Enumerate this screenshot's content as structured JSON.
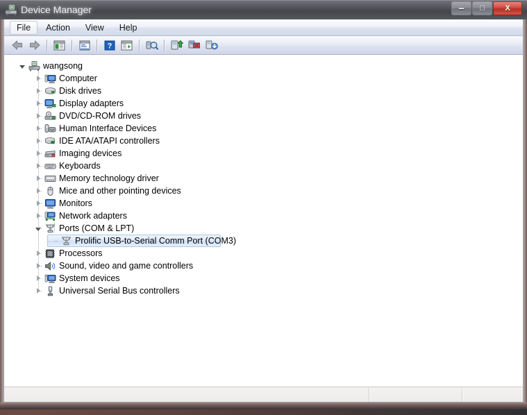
{
  "window": {
    "title": "Device Manager",
    "app_icon": "device-manager-icon",
    "caption": {
      "minimize_label": "–",
      "maximize_label": "□",
      "close_label": "X"
    }
  },
  "menubar": {
    "items": [
      {
        "label": "File",
        "state": "hot"
      },
      {
        "label": "Action",
        "state": "normal"
      },
      {
        "label": "View",
        "state": "normal"
      },
      {
        "label": "Help",
        "state": "normal"
      }
    ]
  },
  "toolbar": {
    "items": [
      {
        "type": "button",
        "icon": "back-arrow-icon",
        "label": "Back"
      },
      {
        "type": "button",
        "icon": "forward-arrow-icon",
        "label": "Forward"
      },
      {
        "type": "separator"
      },
      {
        "type": "button",
        "icon": "show-console-tree-icon",
        "label": "Show/Hide Console Tree"
      },
      {
        "type": "separator"
      },
      {
        "type": "button",
        "icon": "properties-icon",
        "label": "Properties"
      },
      {
        "type": "separator"
      },
      {
        "type": "button",
        "icon": "help-icon",
        "label": "Help"
      },
      {
        "type": "button",
        "icon": "show-detail-pane-icon",
        "label": "Show/Hide Action Pane"
      },
      {
        "type": "separator"
      },
      {
        "type": "button",
        "icon": "scan-hardware-changes-icon",
        "label": "Scan for hardware changes"
      },
      {
        "type": "separator"
      },
      {
        "type": "button",
        "icon": "update-driver-icon",
        "label": "Update Driver Software"
      },
      {
        "type": "button",
        "icon": "disable-device-icon",
        "label": "Disable"
      },
      {
        "type": "button",
        "icon": "uninstall-device-icon",
        "label": "Uninstall"
      }
    ]
  },
  "tree": {
    "root": {
      "label": "wangsong",
      "icon": "computer-root-icon",
      "expanded": true,
      "depth": 0
    },
    "nodes": [
      {
        "label": "Computer",
        "icon": "computer-icon",
        "depth": 1,
        "expanded": false,
        "selected": false
      },
      {
        "label": "Disk drives",
        "icon": "disk-drive-icon",
        "depth": 1,
        "expanded": false,
        "selected": false
      },
      {
        "label": "Display adapters",
        "icon": "display-adapter-icon",
        "depth": 1,
        "expanded": false,
        "selected": false
      },
      {
        "label": "DVD/CD-ROM drives",
        "icon": "dvd-cdrom-icon",
        "depth": 1,
        "expanded": false,
        "selected": false
      },
      {
        "label": "Human Interface Devices",
        "icon": "hid-icon",
        "depth": 1,
        "expanded": false,
        "selected": false
      },
      {
        "label": "IDE ATA/ATAPI controllers",
        "icon": "ide-controller-icon",
        "depth": 1,
        "expanded": false,
        "selected": false
      },
      {
        "label": "Imaging devices",
        "icon": "imaging-device-icon",
        "depth": 1,
        "expanded": false,
        "selected": false
      },
      {
        "label": "Keyboards",
        "icon": "keyboard-icon",
        "depth": 1,
        "expanded": false,
        "selected": false
      },
      {
        "label": "Memory technology driver",
        "icon": "memory-technology-icon",
        "depth": 1,
        "expanded": false,
        "selected": false
      },
      {
        "label": "Mice and other pointing devices",
        "icon": "mouse-icon",
        "depth": 1,
        "expanded": false,
        "selected": false
      },
      {
        "label": "Monitors",
        "icon": "monitor-icon",
        "depth": 1,
        "expanded": false,
        "selected": false
      },
      {
        "label": "Network adapters",
        "icon": "network-adapter-icon",
        "depth": 1,
        "expanded": false,
        "selected": false
      },
      {
        "label": "Ports (COM & LPT)",
        "icon": "port-icon",
        "depth": 1,
        "expanded": true,
        "selected": false
      },
      {
        "label": "Prolific USB-to-Serial Comm Port (COM3)",
        "icon": "port-icon",
        "depth": 2,
        "expanded": null,
        "selected": true
      },
      {
        "label": "Processors",
        "icon": "processor-icon",
        "depth": 1,
        "expanded": false,
        "selected": false
      },
      {
        "label": "Sound, video and game controllers",
        "icon": "sound-controller-icon",
        "depth": 1,
        "expanded": false,
        "selected": false
      },
      {
        "label": "System devices",
        "icon": "system-device-icon",
        "depth": 1,
        "expanded": false,
        "selected": false
      },
      {
        "label": "Universal Serial Bus controllers",
        "icon": "usb-controller-icon",
        "depth": 1,
        "expanded": false,
        "selected": false
      }
    ]
  },
  "statusbar": {
    "cells": [
      "",
      "",
      ""
    ]
  },
  "colors": {
    "selection_border": "#a6cbe8",
    "selection_fill": "#dce8f8",
    "titlebar": "#4a4c52",
    "close_button": "#cf4236",
    "toolbar_gradient_top": "#f8fafd",
    "toolbar_gradient_bottom": "#cfd6e8"
  }
}
